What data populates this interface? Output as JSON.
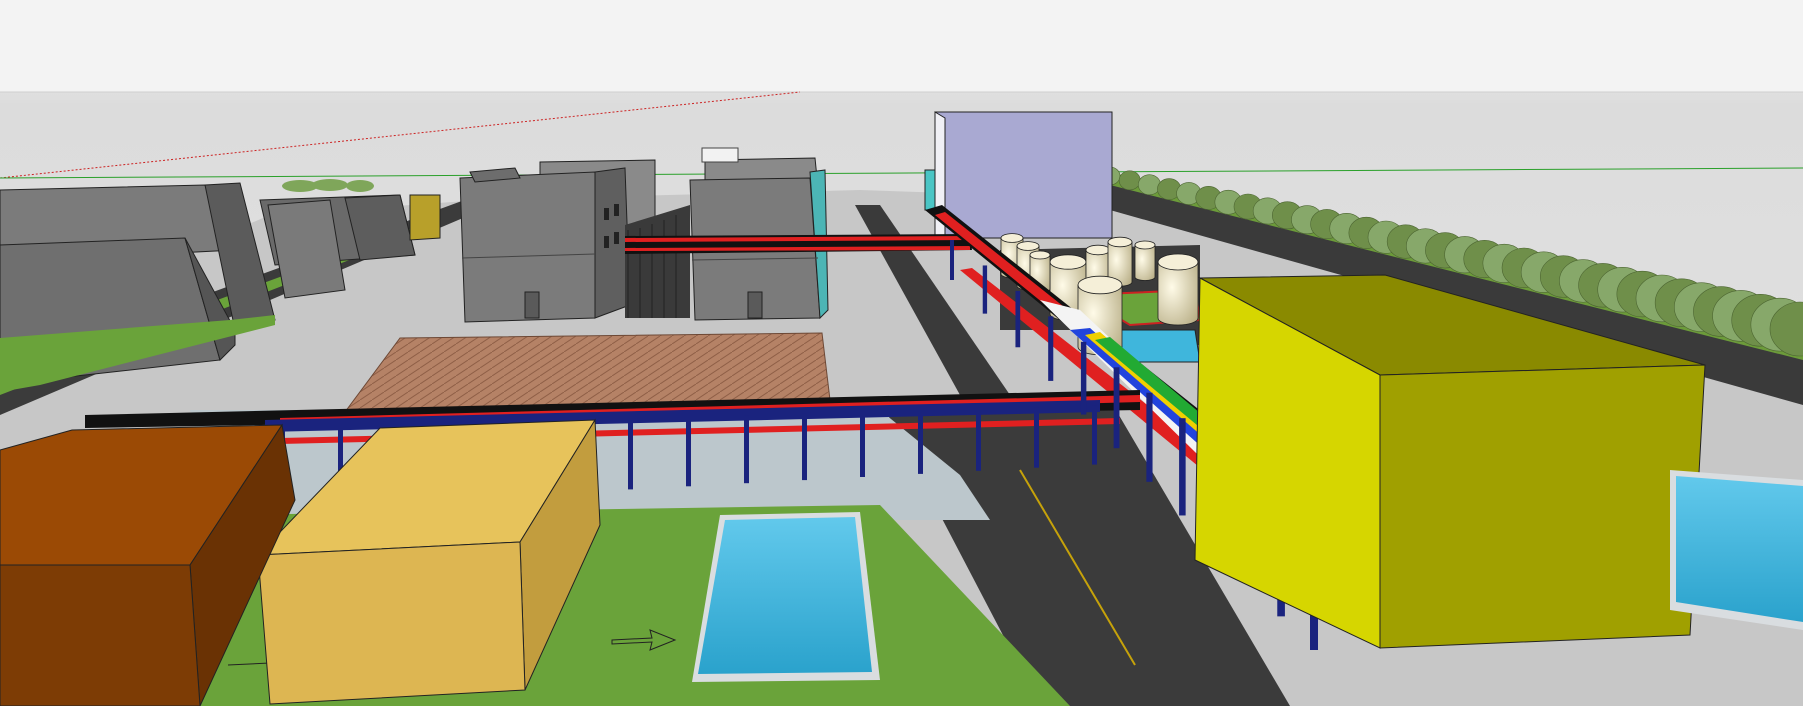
{
  "scene": {
    "sky_color": "#e4e4e4",
    "sky_band_color": "#f0f0f0",
    "ground_color": "#c9c9c9",
    "road_color": "#3a3a3a",
    "grass_color": "#6aa33a",
    "water_color": "#3fb6dc",
    "pipe_colors": {
      "frame": "#1a237e",
      "red": "#e02020",
      "black": "#111111",
      "blue": "#2244dd",
      "yellow": "#f0d000",
      "green": "#22aa33",
      "white": "#f4f4f4"
    },
    "buildings": {
      "lavender_tower": "#a6a6cc",
      "yellow_block": "#d8d800",
      "sand_block": "#e5c25a",
      "brown_block": "#9a4a06",
      "grey_blocks": "#6e6e6e",
      "workshop": "#7a7a7a",
      "paving": "#b07c5e"
    },
    "tank_color": "#ece5c6"
  },
  "signs": {
    "workshop_left": "",
    "workshop_right": "",
    "yellow_block": "",
    "pool": ""
  }
}
